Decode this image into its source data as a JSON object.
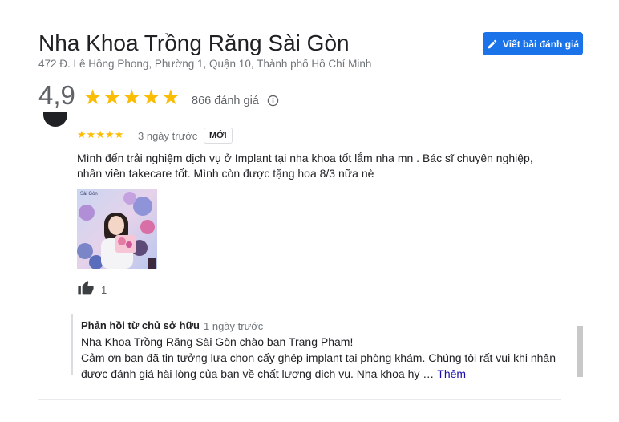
{
  "place": {
    "name": "Nha Khoa Trồng Răng Sài Gòn",
    "address": "472 Đ. Lê Hồng Phong, Phường 1, Quận 10, Thành phố Hồ Chí Minh"
  },
  "header": {
    "write_review_label": "Viết bài đánh giá",
    "pencil_icon": "pencil-icon"
  },
  "summary": {
    "rating": "4,9",
    "stars": "★★★★★",
    "review_count": "866 đánh giá",
    "info_icon": "info-icon"
  },
  "review": {
    "stars": "★★★★★",
    "time": "3 ngày trước",
    "badge": "MỚI",
    "text": "Mình đến trải nghiệm dịch vụ ở Implant tại nha khoa tốt lắm nha mn . Bác sĩ chuyên nghiệp, nhân viên takecare tốt. Mình còn được tặng hoa 8/3 nữa nè",
    "photo_watermark": "Sài Gòn",
    "likes": "1"
  },
  "owner_reply": {
    "label": "Phản hồi từ chủ sở hữu",
    "time": "1 ngày trước",
    "line1": "Nha Khoa Trồng Răng Sài Gòn chào bạn Trang Phạm!",
    "line2": "Cảm ơn bạn đã tin tưởng lựa chọn cấy ghép implant tại phòng khám. Chúng tôi rất vui khi nhận được đánh giá hài lòng của bạn về chất lượng dịch vụ. Nha khoa hy …",
    "more_label": "Thêm"
  },
  "colors": {
    "accent": "#1a73e8",
    "star": "#fbbc04",
    "link": "#1a0dab"
  }
}
